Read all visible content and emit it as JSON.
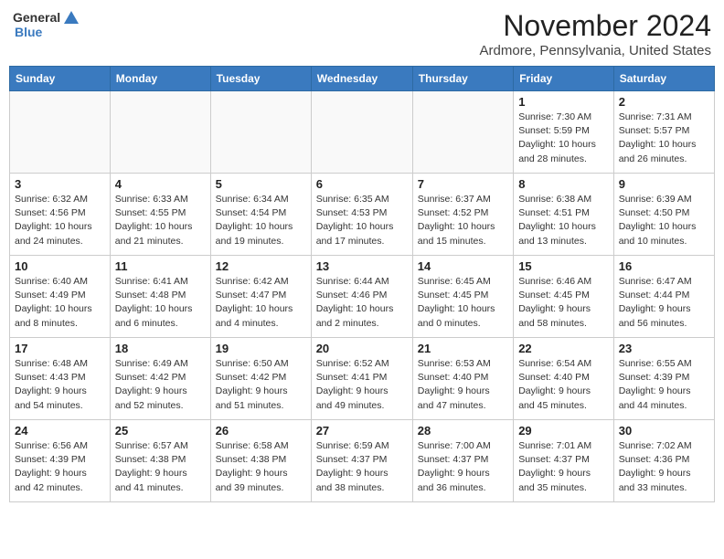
{
  "header": {
    "logo_general": "General",
    "logo_blue": "Blue",
    "month": "November 2024",
    "location": "Ardmore, Pennsylvania, United States"
  },
  "days_of_week": [
    "Sunday",
    "Monday",
    "Tuesday",
    "Wednesday",
    "Thursday",
    "Friday",
    "Saturday"
  ],
  "weeks": [
    [
      {
        "day": "",
        "info": ""
      },
      {
        "day": "",
        "info": ""
      },
      {
        "day": "",
        "info": ""
      },
      {
        "day": "",
        "info": ""
      },
      {
        "day": "",
        "info": ""
      },
      {
        "day": "1",
        "info": "Sunrise: 7:30 AM\nSunset: 5:59 PM\nDaylight: 10 hours\nand 28 minutes."
      },
      {
        "day": "2",
        "info": "Sunrise: 7:31 AM\nSunset: 5:57 PM\nDaylight: 10 hours\nand 26 minutes."
      }
    ],
    [
      {
        "day": "3",
        "info": "Sunrise: 6:32 AM\nSunset: 4:56 PM\nDaylight: 10 hours\nand 24 minutes."
      },
      {
        "day": "4",
        "info": "Sunrise: 6:33 AM\nSunset: 4:55 PM\nDaylight: 10 hours\nand 21 minutes."
      },
      {
        "day": "5",
        "info": "Sunrise: 6:34 AM\nSunset: 4:54 PM\nDaylight: 10 hours\nand 19 minutes."
      },
      {
        "day": "6",
        "info": "Sunrise: 6:35 AM\nSunset: 4:53 PM\nDaylight: 10 hours\nand 17 minutes."
      },
      {
        "day": "7",
        "info": "Sunrise: 6:37 AM\nSunset: 4:52 PM\nDaylight: 10 hours\nand 15 minutes."
      },
      {
        "day": "8",
        "info": "Sunrise: 6:38 AM\nSunset: 4:51 PM\nDaylight: 10 hours\nand 13 minutes."
      },
      {
        "day": "9",
        "info": "Sunrise: 6:39 AM\nSunset: 4:50 PM\nDaylight: 10 hours\nand 10 minutes."
      }
    ],
    [
      {
        "day": "10",
        "info": "Sunrise: 6:40 AM\nSunset: 4:49 PM\nDaylight: 10 hours\nand 8 minutes."
      },
      {
        "day": "11",
        "info": "Sunrise: 6:41 AM\nSunset: 4:48 PM\nDaylight: 10 hours\nand 6 minutes."
      },
      {
        "day": "12",
        "info": "Sunrise: 6:42 AM\nSunset: 4:47 PM\nDaylight: 10 hours\nand 4 minutes."
      },
      {
        "day": "13",
        "info": "Sunrise: 6:44 AM\nSunset: 4:46 PM\nDaylight: 10 hours\nand 2 minutes."
      },
      {
        "day": "14",
        "info": "Sunrise: 6:45 AM\nSunset: 4:45 PM\nDaylight: 10 hours\nand 0 minutes."
      },
      {
        "day": "15",
        "info": "Sunrise: 6:46 AM\nSunset: 4:45 PM\nDaylight: 9 hours\nand 58 minutes."
      },
      {
        "day": "16",
        "info": "Sunrise: 6:47 AM\nSunset: 4:44 PM\nDaylight: 9 hours\nand 56 minutes."
      }
    ],
    [
      {
        "day": "17",
        "info": "Sunrise: 6:48 AM\nSunset: 4:43 PM\nDaylight: 9 hours\nand 54 minutes."
      },
      {
        "day": "18",
        "info": "Sunrise: 6:49 AM\nSunset: 4:42 PM\nDaylight: 9 hours\nand 52 minutes."
      },
      {
        "day": "19",
        "info": "Sunrise: 6:50 AM\nSunset: 4:42 PM\nDaylight: 9 hours\nand 51 minutes."
      },
      {
        "day": "20",
        "info": "Sunrise: 6:52 AM\nSunset: 4:41 PM\nDaylight: 9 hours\nand 49 minutes."
      },
      {
        "day": "21",
        "info": "Sunrise: 6:53 AM\nSunset: 4:40 PM\nDaylight: 9 hours\nand 47 minutes."
      },
      {
        "day": "22",
        "info": "Sunrise: 6:54 AM\nSunset: 4:40 PM\nDaylight: 9 hours\nand 45 minutes."
      },
      {
        "day": "23",
        "info": "Sunrise: 6:55 AM\nSunset: 4:39 PM\nDaylight: 9 hours\nand 44 minutes."
      }
    ],
    [
      {
        "day": "24",
        "info": "Sunrise: 6:56 AM\nSunset: 4:39 PM\nDaylight: 9 hours\nand 42 minutes."
      },
      {
        "day": "25",
        "info": "Sunrise: 6:57 AM\nSunset: 4:38 PM\nDaylight: 9 hours\nand 41 minutes."
      },
      {
        "day": "26",
        "info": "Sunrise: 6:58 AM\nSunset: 4:38 PM\nDaylight: 9 hours\nand 39 minutes."
      },
      {
        "day": "27",
        "info": "Sunrise: 6:59 AM\nSunset: 4:37 PM\nDaylight: 9 hours\nand 38 minutes."
      },
      {
        "day": "28",
        "info": "Sunrise: 7:00 AM\nSunset: 4:37 PM\nDaylight: 9 hours\nand 36 minutes."
      },
      {
        "day": "29",
        "info": "Sunrise: 7:01 AM\nSunset: 4:37 PM\nDaylight: 9 hours\nand 35 minutes."
      },
      {
        "day": "30",
        "info": "Sunrise: 7:02 AM\nSunset: 4:36 PM\nDaylight: 9 hours\nand 33 minutes."
      }
    ]
  ]
}
